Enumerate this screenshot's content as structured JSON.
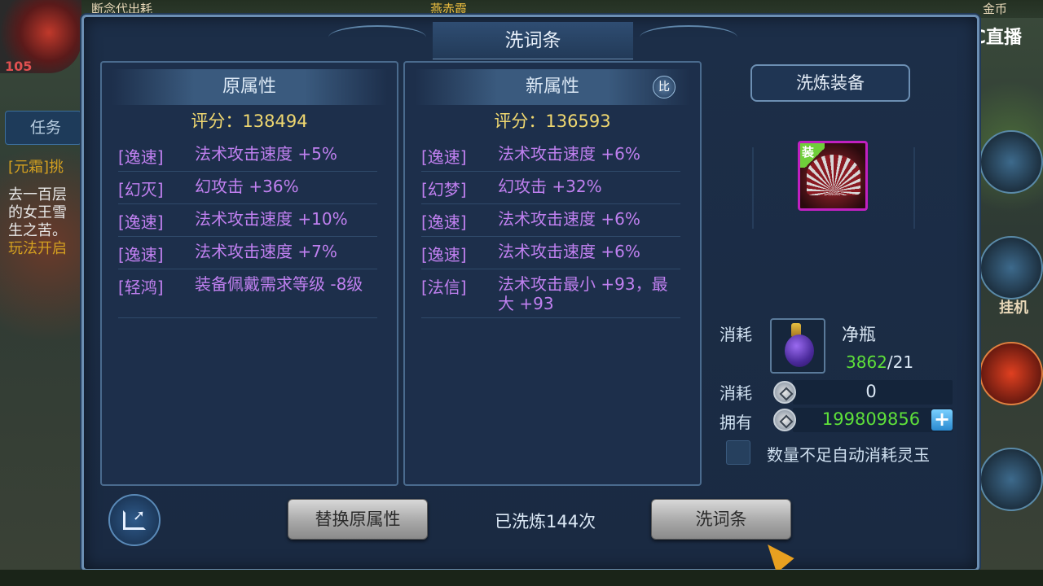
{
  "background": {
    "top_text_left": "断念代出耗",
    "top_text_mid": "燕赤霞",
    "top_text_right": "金币",
    "level": "105",
    "task_tab": "任务",
    "side_quest_lines": [
      "[元霜]挑",
      "去一百层",
      "的女王雪",
      "生之苦。",
      "玩法开启"
    ],
    "right_label": "挂机",
    "stream_logo": "CC直播",
    "stream_logo_mark": "CC"
  },
  "dialog": {
    "title": "洗词条",
    "left_panel": {
      "header": "原属性",
      "score": "评分：138494",
      "attributes": [
        {
          "tag": "[逸速]",
          "text": "法术攻击速度 +5%"
        },
        {
          "tag": "[幻灭]",
          "text": "幻攻击 +36%"
        },
        {
          "tag": "[逸速]",
          "text": "法术攻击速度 +10%"
        },
        {
          "tag": "[逸速]",
          "text": "法术攻击速度 +7%"
        },
        {
          "tag": "[轻鸿]",
          "text": "装备佩戴需求等级 -8级"
        }
      ]
    },
    "right_panel": {
      "header": "新属性",
      "compare_badge": "比",
      "score": "评分：136593",
      "attributes": [
        {
          "tag": "[逸速]",
          "text": "法术攻击速度 +6%"
        },
        {
          "tag": "[幻梦]",
          "text": "幻攻击 +32%"
        },
        {
          "tag": "[逸速]",
          "text": "法术攻击速度 +6%"
        },
        {
          "tag": "[逸速]",
          "text": "法术攻击速度 +6%"
        },
        {
          "tag": "[法信]",
          "text": "法术攻击最小 +93，最大 +93"
        }
      ]
    },
    "equip": {
      "title": "洗炼装备",
      "badge": "装"
    },
    "cost": {
      "consume_label": "消耗",
      "item_name": "净瓶",
      "item_have": "3862",
      "item_need": "/21",
      "coin_consume_label": "消耗",
      "coin_consume_value": "0",
      "own_label": "拥有",
      "own_value": "199809856",
      "plus": "+",
      "auto_jade_label": "数量不足自动消耗灵玉"
    },
    "bottom": {
      "replace_button": "替换原属性",
      "wash_count": "已洗炼144次",
      "wash_button": "洗词条"
    }
  }
}
